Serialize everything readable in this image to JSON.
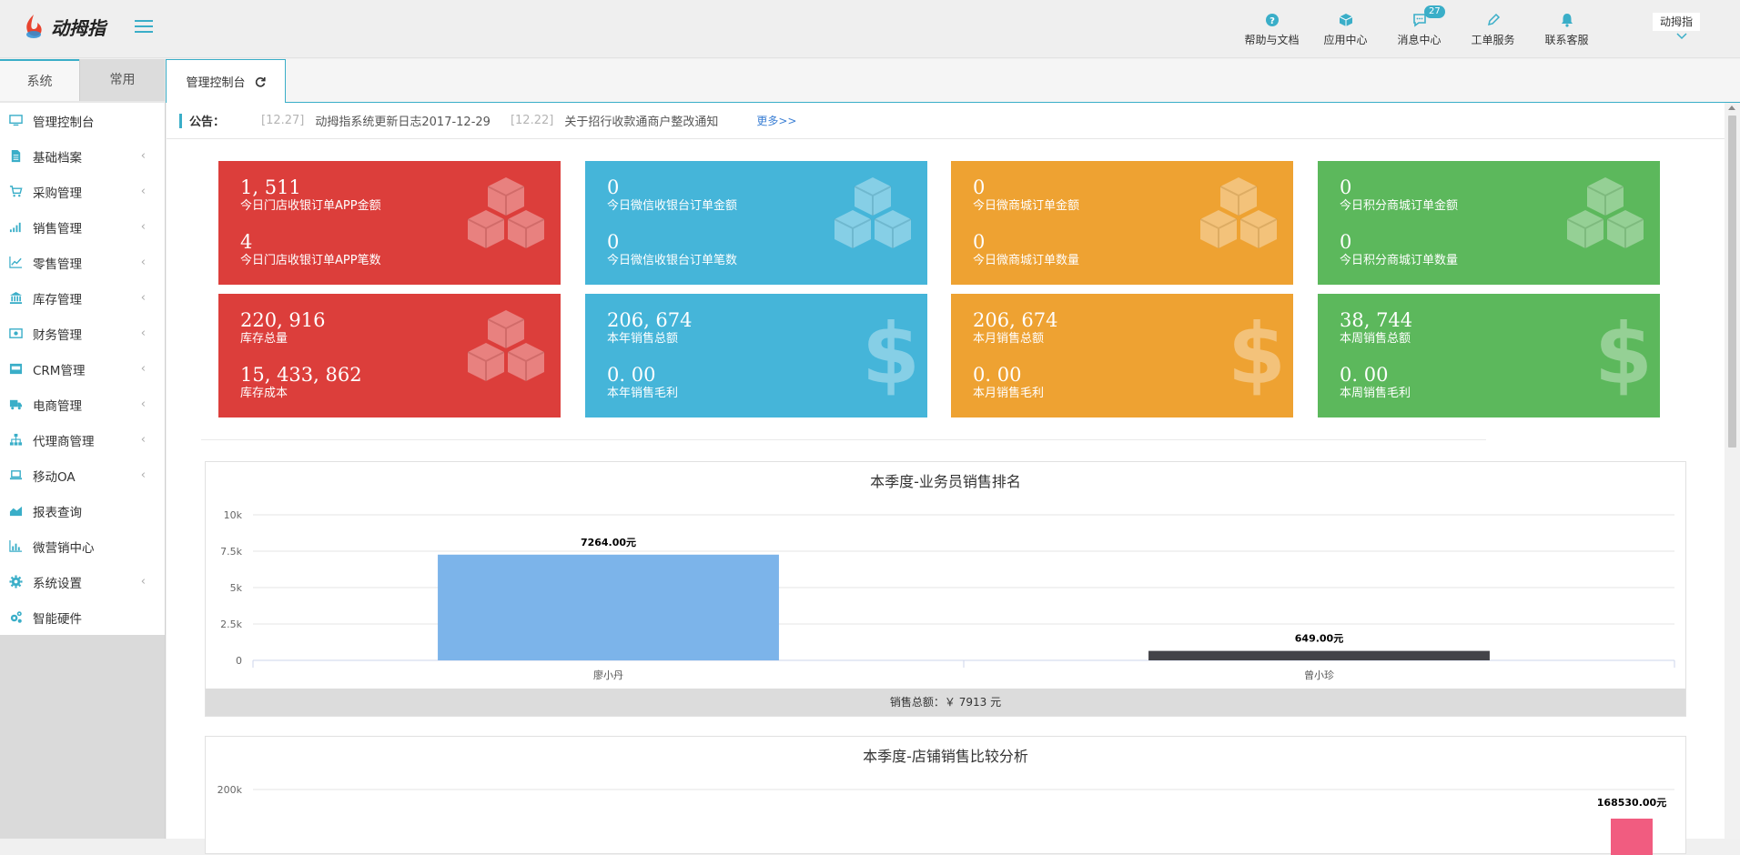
{
  "app": {
    "brand": "动拇指"
  },
  "topnav": [
    {
      "label": "帮助与文档",
      "icon": "help-icon"
    },
    {
      "label": "应用中心",
      "icon": "cube-icon"
    },
    {
      "label": "消息中心",
      "icon": "message-icon",
      "badge": "27"
    },
    {
      "label": "工单服务",
      "icon": "pencil-icon"
    },
    {
      "label": "联系客服",
      "icon": "bell-icon"
    }
  ],
  "user": {
    "name": "动拇指"
  },
  "sidebar": {
    "tabs": [
      "系统",
      "常用"
    ],
    "items": [
      {
        "label": "管理控制台",
        "icon": "monitor-icon",
        "expandable": false
      },
      {
        "label": "基础档案",
        "icon": "file-icon",
        "expandable": true
      },
      {
        "label": "采购管理",
        "icon": "cart-icon",
        "expandable": true
      },
      {
        "label": "销售管理",
        "icon": "signal-icon",
        "expandable": true
      },
      {
        "label": "零售管理",
        "icon": "line-chart-icon",
        "expandable": true
      },
      {
        "label": "库存管理",
        "icon": "bank-icon",
        "expandable": true
      },
      {
        "label": "财务管理",
        "icon": "money-icon",
        "expandable": true
      },
      {
        "label": "CRM管理",
        "icon": "inbox-icon",
        "expandable": true
      },
      {
        "label": "电商管理",
        "icon": "truck-icon",
        "expandable": true
      },
      {
        "label": "代理商管理",
        "icon": "sitemap-icon",
        "expandable": true
      },
      {
        "label": "移动OA",
        "icon": "laptop-icon",
        "expandable": true
      },
      {
        "label": "报表查询",
        "icon": "area-chart-icon",
        "expandable": false
      },
      {
        "label": "微营销中心",
        "icon": "bar-chart-icon",
        "expandable": false
      },
      {
        "label": "系统设置",
        "icon": "gear-icon",
        "expandable": true
      },
      {
        "label": "智能硬件",
        "icon": "cogs-icon",
        "expandable": false
      }
    ]
  },
  "page_tab": {
    "label": "管理控制台"
  },
  "notice": {
    "title": "公告：",
    "items": [
      {
        "date": "[12.27]",
        "text": "动拇指系统更新日志2017-12-29"
      },
      {
        "date": "[12.22]",
        "text": "关于招行收款通商户整改通知"
      }
    ],
    "more": "更多>>"
  },
  "cards": [
    {
      "color": "red",
      "deco": "cubes",
      "v1": "1, 511",
      "l1": "今日门店收银订单APP金额",
      "v2": "4",
      "l2": "今日门店收银订单APP笔数"
    },
    {
      "color": "blue",
      "deco": "cubes",
      "v1": "0",
      "l1": "今日微信收银台订单金额",
      "v2": "0",
      "l2": "今日微信收银台订单笔数"
    },
    {
      "color": "orange",
      "deco": "cubes",
      "v1": "0",
      "l1": "今日微商城订单金额",
      "v2": "0",
      "l2": "今日微商城订单数量"
    },
    {
      "color": "green",
      "deco": "cubes",
      "v1": "0",
      "l1": "今日积分商城订单金额",
      "v2": "0",
      "l2": "今日积分商城订单数量"
    },
    {
      "color": "red",
      "deco": "cubes",
      "v1": "220, 916",
      "l1": "库存总量",
      "v2": "15, 433, 862",
      "l2": "库存成本"
    },
    {
      "color": "blue",
      "deco": "dollar",
      "v1": "206, 674",
      "l1": "本年销售总额",
      "v2": "0. 00",
      "l2": "本年销售毛利"
    },
    {
      "color": "orange",
      "deco": "dollar",
      "v1": "206, 674",
      "l1": "本月销售总额",
      "v2": "0. 00",
      "l2": "本月销售毛利"
    },
    {
      "color": "green",
      "deco": "dollar",
      "v1": "38, 744",
      "l1": "本周销售总额",
      "v2": "0. 00",
      "l2": "本周销售毛利"
    }
  ],
  "colors": {
    "red": "#dc3e3b",
    "blue": "#45b5d9",
    "orange": "#eea232",
    "green": "#5cb85c",
    "accent": "#3aaec8"
  },
  "chart_data": [
    {
      "type": "bar",
      "title": "本季度-业务员销售排名",
      "categories": [
        "廖小丹",
        "曾小珍"
      ],
      "values": [
        7264.0,
        649.0
      ],
      "data_labels": [
        "7264.00元",
        "649.00元"
      ],
      "bar_colors": [
        "#7cb4ea",
        "#434348"
      ],
      "ylim": [
        0,
        10000
      ],
      "yticks": [
        "0",
        "2.5k",
        "5k",
        "7.5k",
        "10k"
      ],
      "ytick_values": [
        0,
        2500,
        5000,
        7500,
        10000
      ],
      "grid": true,
      "footer": "销售总额：￥ 7913 元"
    },
    {
      "type": "bar",
      "title": "本季度-店铺销售比较分析",
      "ytick_label_visible": "200k",
      "data_labels": [
        "168530.00元"
      ],
      "values": [
        168530.0
      ],
      "bar_colors": [
        "#f15c80"
      ]
    }
  ]
}
